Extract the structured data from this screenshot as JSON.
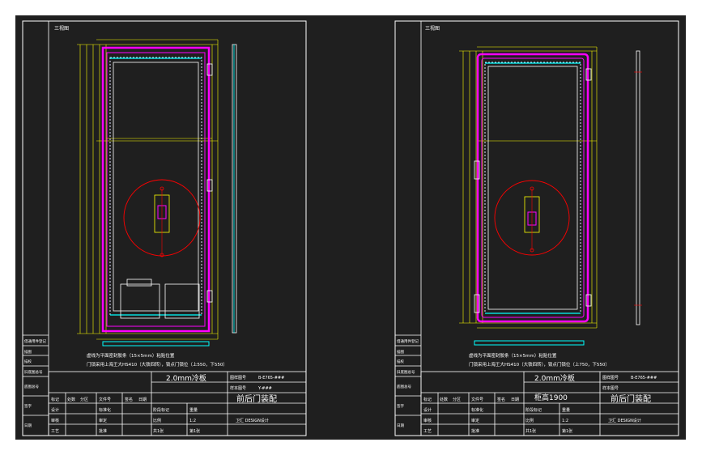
{
  "sheets": [
    {
      "view_label": "三视图",
      "note_line1": "虚线为平面密封胶条（15×5mm）粘贴位置",
      "note_line2": "门锁采用上海王大HS410（大铁四转），锁点门锁位（上550，下550）",
      "material": "2.0mm冷板",
      "cabinet_height": "",
      "title": "前后门装配",
      "drawing_no_label": "图样图号",
      "drawing_no": "B-E765-###",
      "sample_label": "样本图号",
      "sample_value": "Y-###",
      "designer": "设计",
      "std_label": "标准化",
      "approve": "审核",
      "process": "工艺",
      "check": "审定",
      "date": "日期",
      "approve2": "批准",
      "mark": "标记",
      "count": "处数",
      "zone": "分区",
      "doc_no": "文件号",
      "sign": "签名",
      "stage": "阶段标记",
      "weight": "重量",
      "scale_label": "比例",
      "scale": "1:2",
      "sheets_total": "共1张",
      "sheet_no": "第1张",
      "company": "卫汇 DESIGN设计",
      "left_labels": [
        "借通用件登记",
        "描图",
        "描校",
        "旧底图总号",
        "底图总号",
        "签字",
        "日期"
      ]
    },
    {
      "view_label": "三视图",
      "note_line1": "虚线为平面密封胶条（15×5mm）粘贴位置",
      "note_line2": "门锁采用上海王大HS410（大铁四转），锁点门锁位（上750，下550）",
      "material": "2.0mm冷板",
      "cabinet_height": "柜高1900",
      "title": "前后门装配",
      "drawing_no_label": "图样图号",
      "drawing_no": "B-E765-###",
      "sample_label": "样本图号",
      "sample_value": "",
      "designer": "设计",
      "std_label": "标准化",
      "approve": "审核",
      "process": "工艺",
      "check": "审定",
      "date": "日期",
      "approve2": "批准",
      "mark": "标记",
      "count": "处数",
      "zone": "分区",
      "doc_no": "文件号",
      "sign": "签名",
      "stage": "阶段标记",
      "weight": "重量",
      "scale_label": "比例",
      "scale": "1:2",
      "sheets_total": "共1张",
      "sheet_no": "第1张",
      "company": "卫汇 DESIGN设计",
      "left_labels": [
        "借通用件登记",
        "描图",
        "描校",
        "旧底图总号",
        "底图总号",
        "签字",
        "日期"
      ]
    }
  ],
  "colors": {
    "background": "#1f1f1f",
    "page": "#ffffff",
    "lines": "#ffffff",
    "door": "#ff00ff",
    "dims": "#ffff00",
    "seal": "#00ffff",
    "detail": "#ff0000"
  }
}
